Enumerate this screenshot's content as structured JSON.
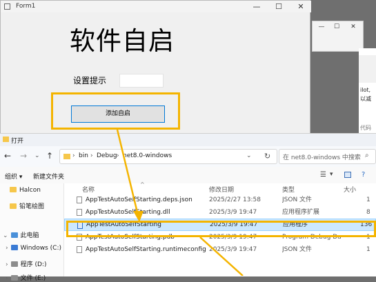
{
  "form1": {
    "title": "Form1",
    "heading": "软件自启",
    "hint_label": "设置提示",
    "hint_value": "",
    "button_label": "添加自启",
    "controls": {
      "minimize": "—",
      "maximize": "☐",
      "close": "✕"
    }
  },
  "background_window": {
    "controls": {
      "minimize": "—",
      "maximize": "☐",
      "close": "✕"
    },
    "snippet_1": "ilot,",
    "snippet_2": "以减",
    "snippet_3": "代码"
  },
  "explorer": {
    "title": "打开",
    "address": [
      "bin",
      "Debug",
      "net8.0-windows"
    ],
    "search_placeholder": "在 net8.0-windows 中搜索",
    "toolbar": {
      "organize": "组织 ▾",
      "new_folder": "新建文件夹"
    },
    "nav": {
      "items": [
        "Halcon",
        "铅笔绘图",
        "此电脑",
        "Windows (C:)",
        "程序 (D:)",
        "文件 (E:)"
      ]
    },
    "columns": {
      "name": "名称",
      "date": "修改日期",
      "type": "类型",
      "size": "大小"
    },
    "files": [
      {
        "name": "AppTestAutoSelfStarting.deps.json",
        "date": "2025/2/27 13:58",
        "type": "JSON 文件",
        "size": "1"
      },
      {
        "name": "AppTestAutoSelfStarting.dll",
        "date": "2025/3/9 19:47",
        "type": "应用程序扩展",
        "size": "8"
      },
      {
        "name": "AppTestAutoSelfStarting",
        "date": "2025/3/9 19:47",
        "type": "应用程序",
        "size": "136 K",
        "selected": true
      },
      {
        "name": "AppTestAutoSelfStarting.pdb",
        "date": "2025/3/9 19:47",
        "type": "Program Debug Da...",
        "size": "1"
      },
      {
        "name": "AppTestAutoSelfStarting.runtimeconfig.json",
        "date": "2025/3/9 19:47",
        "type": "JSON 文件",
        "size": "1"
      }
    ]
  },
  "colors": {
    "highlight": "#f4b400",
    "selection": "#cce8ff",
    "button_border": "#0078d7"
  }
}
